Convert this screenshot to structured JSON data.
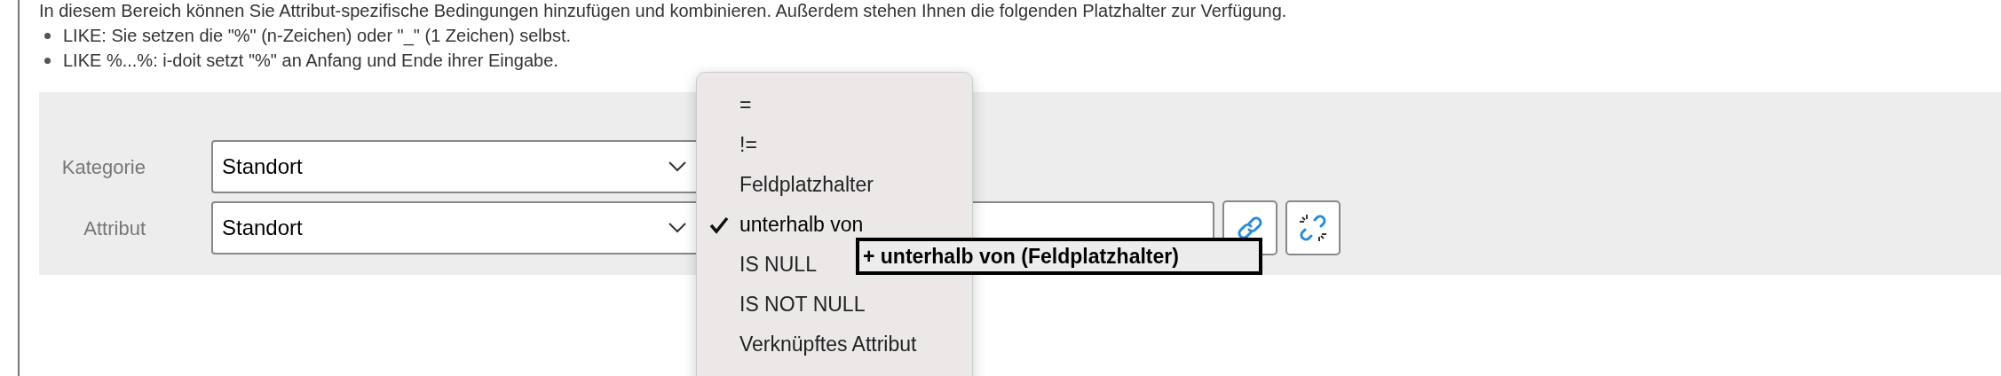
{
  "intro": "In diesem Bereich können Sie Attribut-spezifische Bedingungen hinzufügen und kombinieren. Außerdem stehen Ihnen die folgenden Platzhalter zur Verfügung.",
  "bullets": [
    "LIKE: Sie setzen die \"%\" (n-Zeichen) oder \"_\" (1 Zeichen) selbst.",
    "LIKE %...%: i-doit setzt \"%\" an Anfang und Ende ihrer Eingabe."
  ],
  "form": {
    "rows": [
      {
        "label": "Kategorie",
        "value": "Standort"
      },
      {
        "label": "Attribut",
        "value": "Standort"
      }
    ]
  },
  "operator_menu": {
    "items": [
      {
        "label": "=",
        "selected": false
      },
      {
        "label": "!=",
        "selected": false
      },
      {
        "label": "Feldplatzhalter",
        "selected": false
      },
      {
        "label": "unterhalb von",
        "selected": true
      },
      {
        "label": "IS NULL",
        "selected": false
      },
      {
        "label": "IS NOT NULL",
        "selected": false
      },
      {
        "label": "Verknüpftes Attribut",
        "selected": false
      }
    ]
  },
  "tooltip": "+ unterhalb von (Feldplatzhalter)"
}
